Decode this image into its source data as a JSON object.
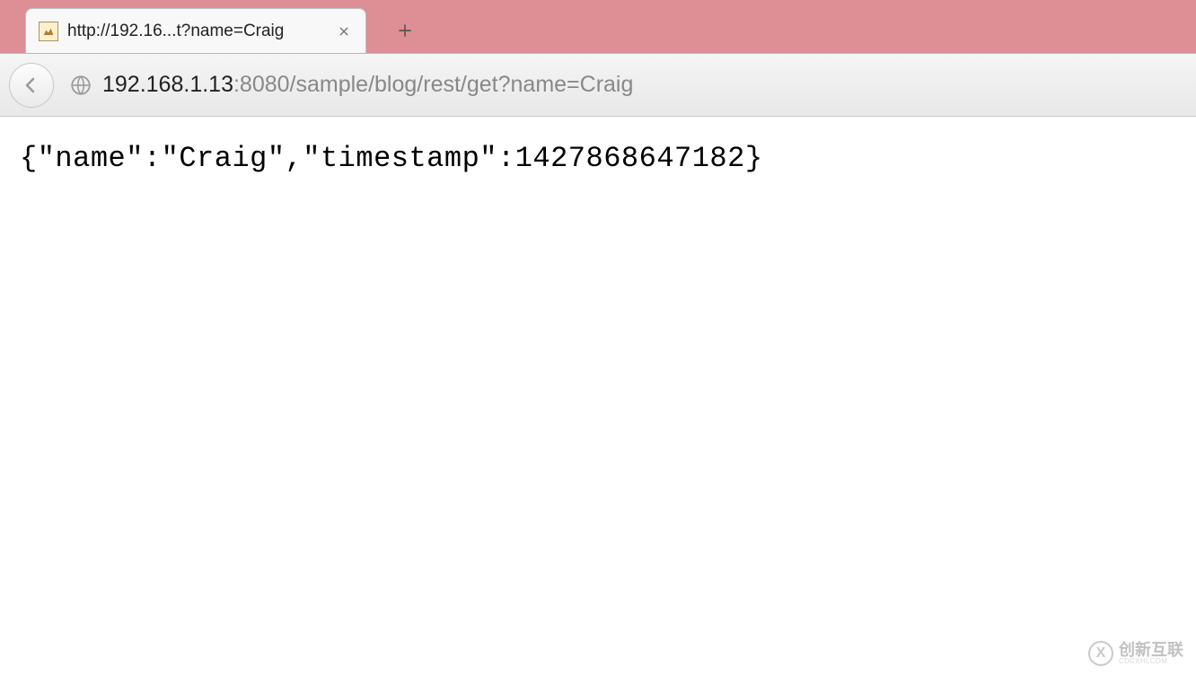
{
  "tab": {
    "title": "http://192.16...t?name=Craig"
  },
  "toolbar": {
    "url_host": "192.168.1.13",
    "url_path": ":8080/sample/blog/rest/get?name=Craig",
    "full_url": "192.168.1.13:8080/sample/blog/rest/get?name=Craig"
  },
  "page": {
    "body_text": "{\"name\":\"Craig\",\"timestamp\":1427868647182}"
  },
  "watermark": {
    "symbol": "X",
    "main": "创新互联",
    "sub": "CDCXHLCOM"
  }
}
